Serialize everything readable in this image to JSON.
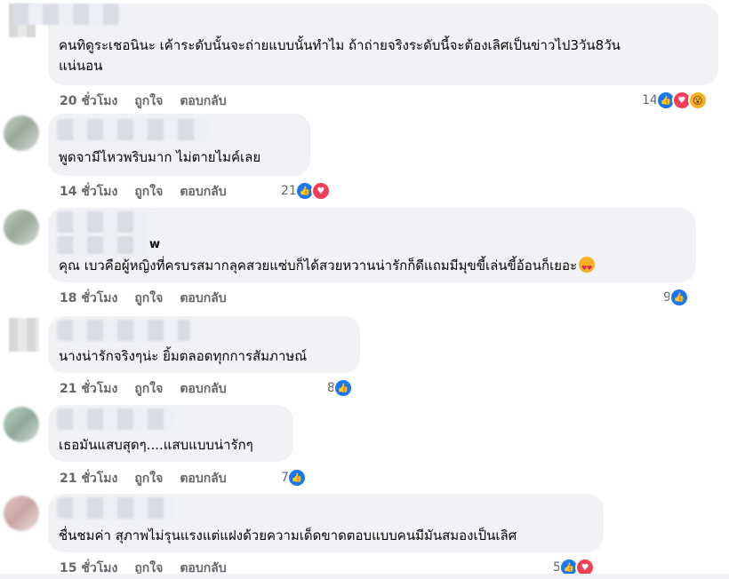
{
  "comments": [
    {
      "text_lines": [
        "คนทิดูระเชอนินะ เค้าระดับนั้นจะถ่ายแบบนั้นทำไม ถ้าถ่ายจริงระดับนี้จะต้องเลิศเป็นข่าวไป3วัน8วัน",
        "แน่นอน"
      ],
      "time": "20 ชั่วโมง",
      "like_label": "ถูกใจ",
      "reply_label": "ตอบกลับ",
      "reaction_count": "14",
      "reactions": [
        "like-icon",
        "love-icon",
        "wow-icon"
      ]
    },
    {
      "text_lines": [
        "พูดจามีไหวพริบมาก ไม่ตายไมค์เลย"
      ],
      "time": "14 ชั่วโมง",
      "like_label": "ถูกใจ",
      "reply_label": "ตอบกลับ",
      "reaction_count": "21",
      "reactions": [
        "like-icon",
        "love-icon"
      ]
    },
    {
      "text_lines": [
        "คุณ เบวคือผู้หญิงที่ครบรสมากลุคสวยแซ่บก็ได้สวยหวานน่ารักก็ดีแถมมีมุขขี้เล่นขี้อ้อนก็เยอะ"
      ],
      "name_tail": "w",
      "time": "18 ชั่วโมง",
      "like_label": "ถูกใจ",
      "reply_label": "ตอบกลับ",
      "reaction_count": "9",
      "reactions": [
        "like-icon"
      ]
    },
    {
      "text_lines": [
        "นางน่ารักจริงๆน่ะ ยิ้มตลอดทุกการสัมภาษณ์"
      ],
      "time": "21 ชั่วโมง",
      "like_label": "ถูกใจ",
      "reply_label": "ตอบกลับ",
      "reaction_count": "8",
      "reactions": [
        "like-icon"
      ]
    },
    {
      "text_lines": [
        "เธอมันแสบสุดๆ....แสบแบบน่ารักๆ"
      ],
      "time": "21 ชั่วโมง",
      "like_label": "ถูกใจ",
      "reply_label": "ตอบกลับ",
      "reaction_count": "7",
      "reactions": [
        "like-icon"
      ]
    },
    {
      "text_lines": [
        "ชื่นชมค่า สุภาพไม่รุนแรงแต่แฝงด้วยความเด็ดขาดตอบแบบคนมีมันสมองเป็นเลิศ"
      ],
      "time": "15 ชั่วโมง",
      "like_label": "ถูกใจ",
      "reply_label": "ตอบกลับ",
      "reaction_count": "5",
      "reactions": [
        "like-icon",
        "love-icon"
      ]
    }
  ]
}
